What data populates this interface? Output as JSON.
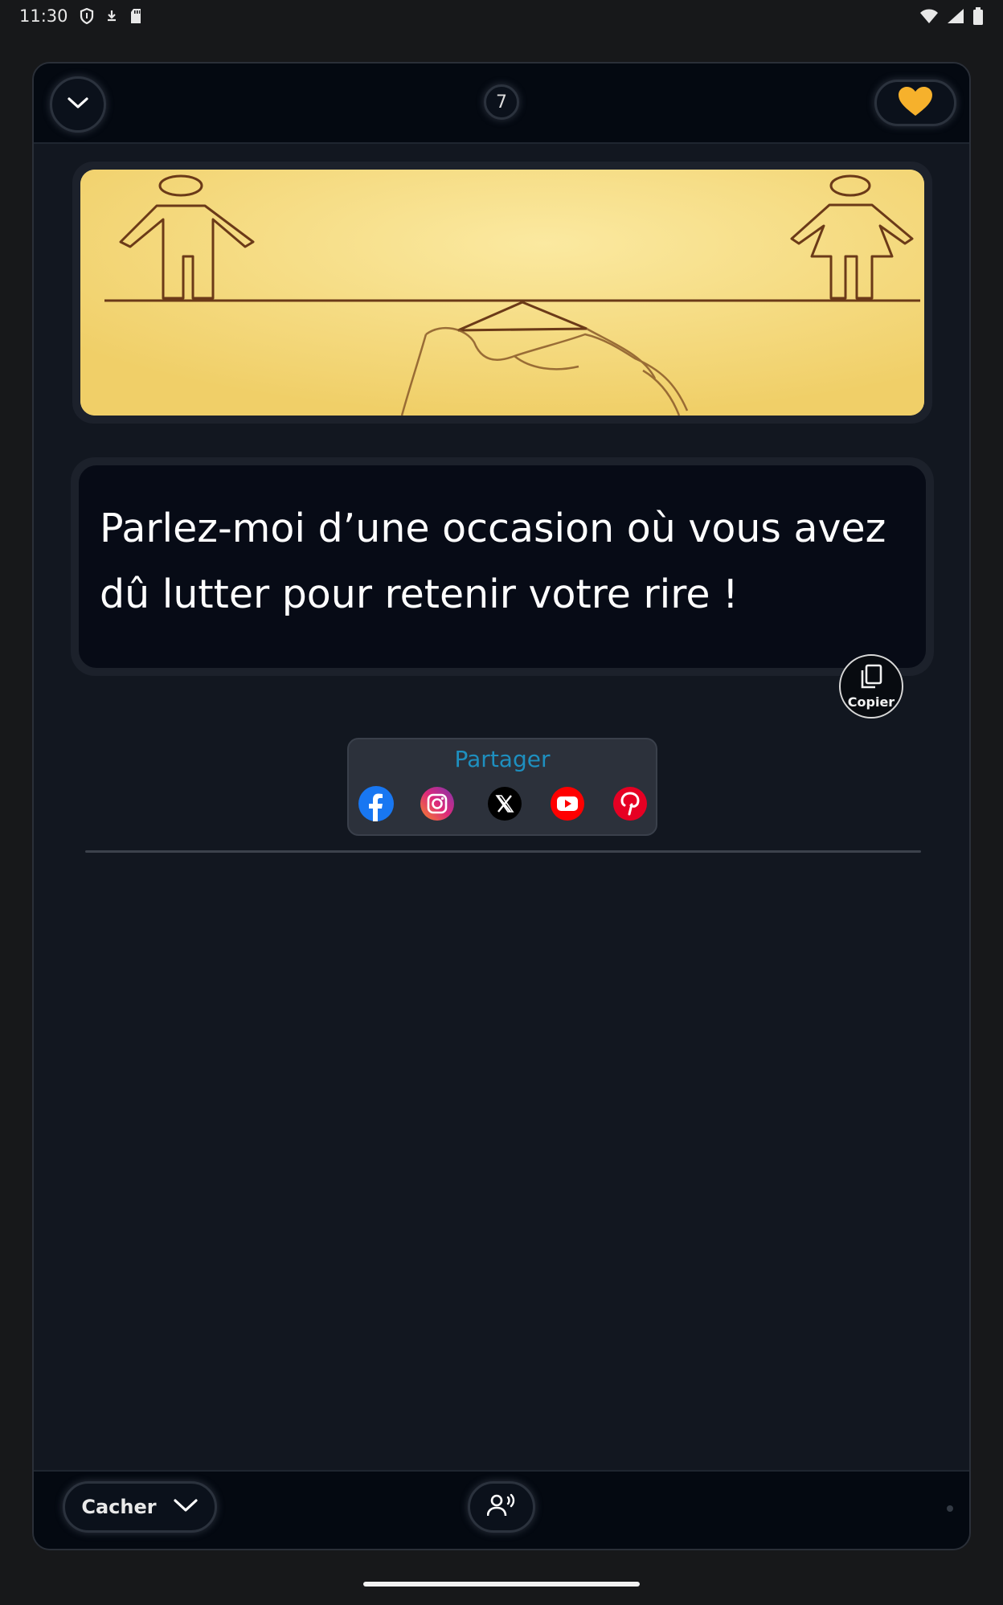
{
  "status_bar": {
    "time": "11:30",
    "icons_left": [
      "vpn-shield-icon",
      "download-icon",
      "sd-card-icon"
    ],
    "icons_right": [
      "wifi-icon",
      "signal-icon",
      "battery-icon"
    ]
  },
  "header": {
    "collapse_icon": "chevron-down-icon",
    "counter": "7",
    "favorite_icon": "heart-icon",
    "favorite_color": "#f6b12c"
  },
  "illustration": {
    "description_icon": "man-woman-balance-illustration"
  },
  "question": {
    "text": "Parlez-moi d’une occasion où vous avez dû lutter pour retenir votre rire !"
  },
  "copy_button": {
    "label": "Copier",
    "icon": "copy-icon"
  },
  "share": {
    "title": "Partager",
    "title_color": "#1e8fbf",
    "networks": [
      {
        "icon": "facebook-icon",
        "color": "#1877f2"
      },
      {
        "icon": "instagram-icon",
        "color": "#e1306c"
      },
      {
        "icon": "x-icon",
        "color": "#000000"
      },
      {
        "icon": "youtube-icon",
        "color": "#ff0000"
      },
      {
        "icon": "pinterest-icon",
        "color": "#e60023"
      }
    ]
  },
  "footer": {
    "hide_label": "Cacher",
    "hide_icon": "chevron-down-icon",
    "speak_icon": "voice-icon"
  }
}
